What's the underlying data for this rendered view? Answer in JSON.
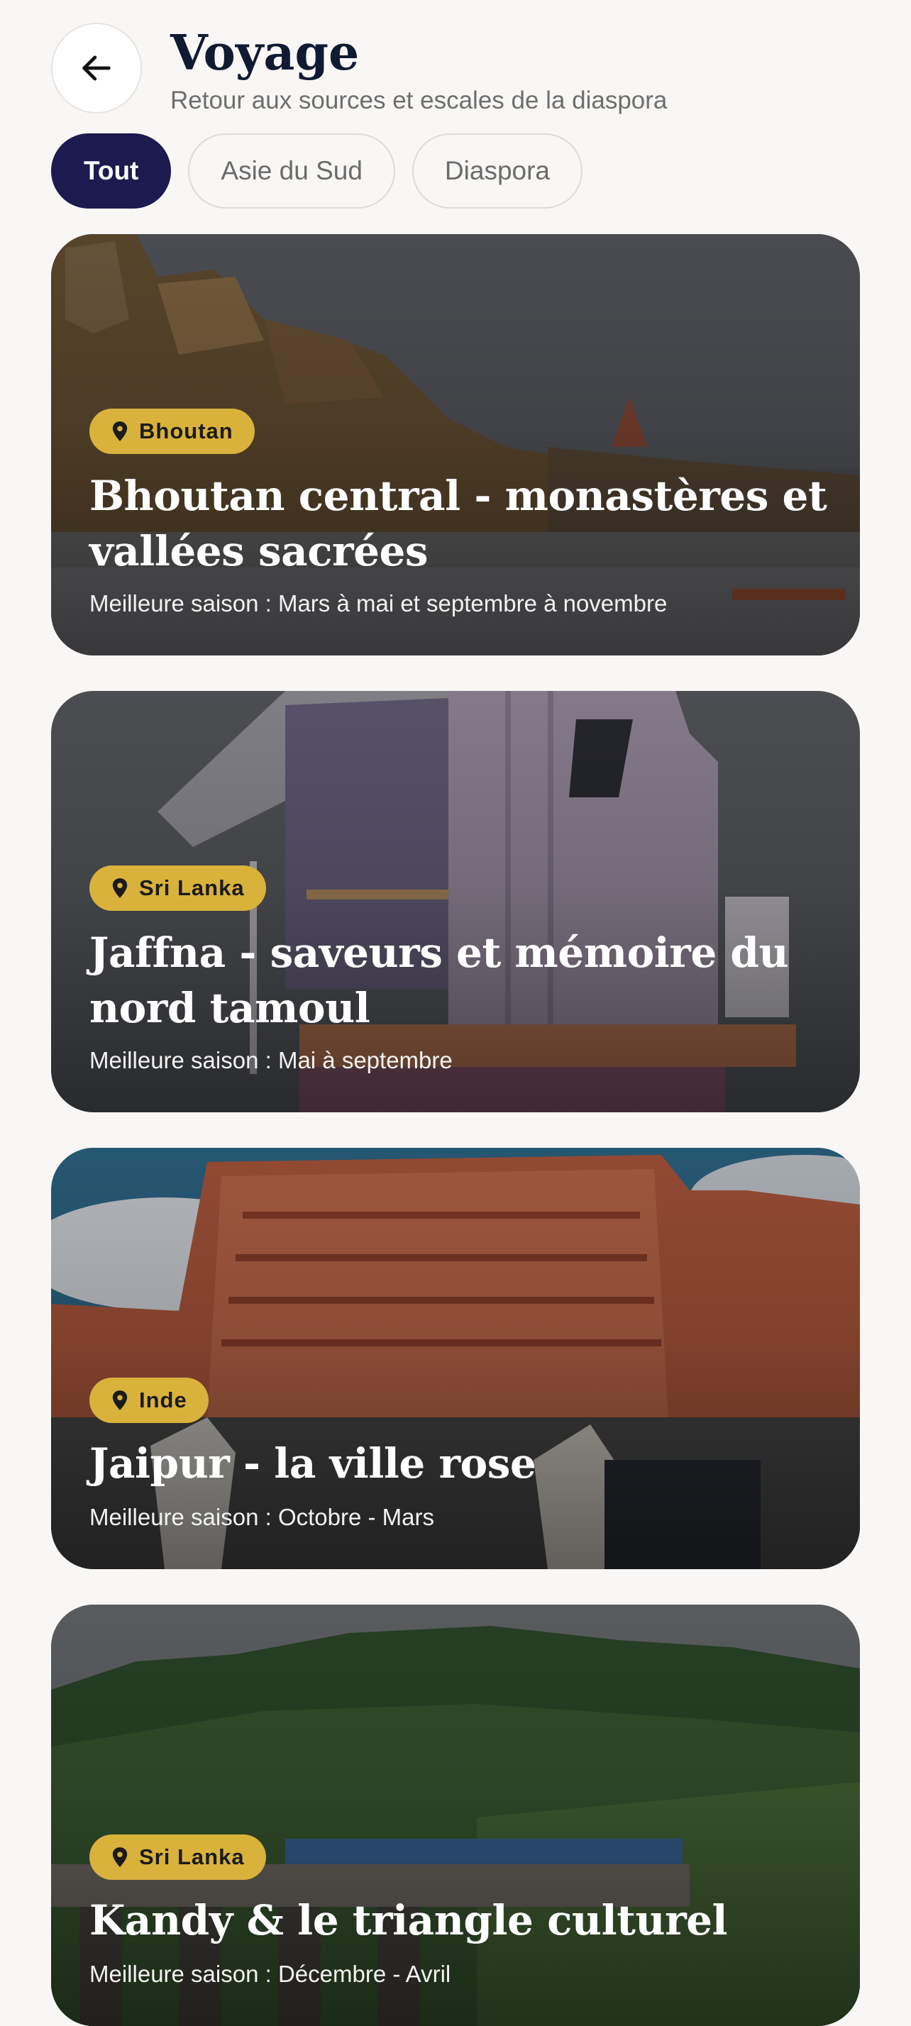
{
  "header": {
    "title": "Voyage",
    "subtitle": "Retour aux sources et escales de la diaspora"
  },
  "filters": [
    {
      "label": "Tout",
      "active": true
    },
    {
      "label": "Asie du Sud",
      "active": false
    },
    {
      "label": "Diaspora",
      "active": false
    }
  ],
  "cards": [
    {
      "badge": "Bhoutan",
      "title": "Bhoutan central - monastères et vallées sacrées",
      "season": "Meilleure saison : Mars à mai et septembre à novembre",
      "photo_icon": "ghats-riverside-photo"
    },
    {
      "badge": "Sri Lanka",
      "title": "Jaffna - saveurs et mémoire du nord tamoul",
      "season": "Meilleure saison : Mai à septembre",
      "photo_icon": "lifeguard-tower-photo"
    },
    {
      "badge": "Inde",
      "title": "Jaipur - la ville rose",
      "season": "Meilleure saison : Octobre - Mars",
      "photo_icon": "hawa-mahal-photo"
    },
    {
      "badge": "Sri Lanka",
      "title": "Kandy & le triangle culturel",
      "season": "Meilleure saison : Décembre - Avril",
      "photo_icon": "jungle-train-bridge-photo"
    }
  ],
  "colors": {
    "background": "#f8f7f5",
    "title": "#111a33",
    "active_chip": "#1c1a4e",
    "badge": "#d9b23c"
  }
}
